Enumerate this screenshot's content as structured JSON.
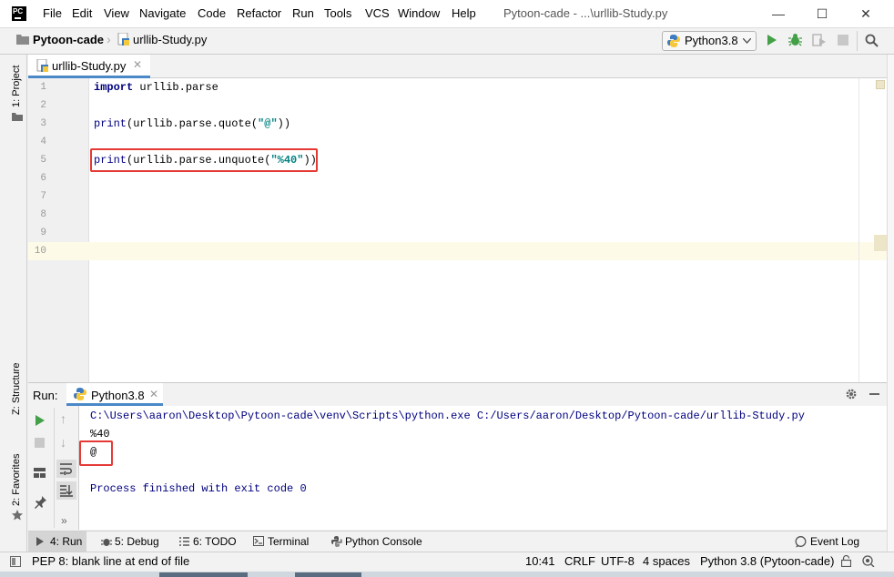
{
  "window": {
    "title": "Pytoon-cade - ...\\urllib-Study.py",
    "logo_text": "PC",
    "minimize_glyph": "—",
    "maximize_glyph": "☐",
    "close_glyph": "✕"
  },
  "menu": [
    "File",
    "Edit",
    "View",
    "Navigate",
    "Code",
    "Refactor",
    "Run",
    "Tools",
    "VCS",
    "Window",
    "Help"
  ],
  "breadcrumb": {
    "project": "Pytoon-cade",
    "file": "urllib-Study.py"
  },
  "run_config": "Python3.8",
  "left_stripe": {
    "project": "1: Project",
    "structure": "Z: Structure",
    "favorites": "2: Favorites"
  },
  "editor": {
    "tab_label": "urllib-Study.py",
    "line_numbers": [
      "1",
      "2",
      "3",
      "4",
      "5",
      "6",
      "7",
      "8",
      "9",
      "10"
    ],
    "line1_kw": "import",
    "line1_rest": " urllib.parse",
    "line3_fn": "print",
    "line3_mid": "(urllib.parse.quote(",
    "line3_str": "\"@\"",
    "line3_end": "))",
    "line5_fn": "print",
    "line5_mid": "(urllib.parse.unquote(",
    "line5_str": "\"%40\"",
    "line5_end": "))"
  },
  "run_panel": {
    "label": "Run:",
    "tab": "Python3.8",
    "console": [
      "C:\\Users\\aaron\\Desktop\\Pytoon-cade\\venv\\Scripts\\python.exe C:/Users/aaron/Desktop/Pytoon-cade/urllib-Study.py",
      "%40",
      "@",
      "",
      "Process finished with exit code 0"
    ]
  },
  "bottom_tools": {
    "run": "4: Run",
    "debug": "5: Debug",
    "todo": "6: TODO",
    "terminal": "Terminal",
    "python_console": "Python Console",
    "event_log": "Event Log"
  },
  "status": {
    "message": "PEP 8: blank line at end of file",
    "position": "10:41",
    "line_sep": "CRLF",
    "encoding": "UTF-8",
    "indent": "4 spaces",
    "interpreter": "Python 3.8 (Pytoon-cade)"
  },
  "colors": {
    "highlight": "#e53935",
    "accent": "#4a88c7",
    "keyword": "#000080",
    "string": "#008080",
    "run_green": "#43a047",
    "console_blue": "#000080"
  }
}
